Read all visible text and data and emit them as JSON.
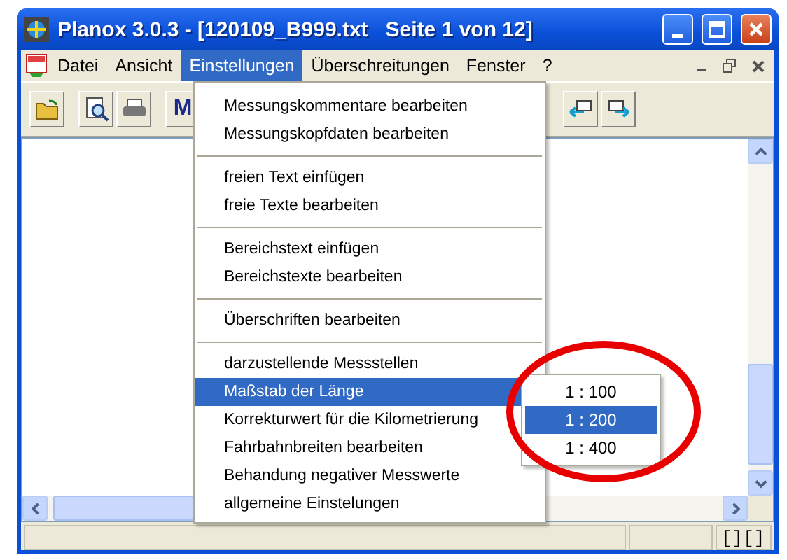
{
  "window": {
    "title": "Planox 3.0.3 - [120109_B999.txt   Seite 1 von 12]"
  },
  "menubar": [
    {
      "label": "Datei",
      "selected": false
    },
    {
      "label": "Ansicht",
      "selected": false
    },
    {
      "label": "Einstellungen",
      "selected": true
    },
    {
      "label": "Überschreitungen",
      "selected": false
    },
    {
      "label": "Fenster",
      "selected": false
    },
    {
      "label": "?",
      "selected": false
    }
  ],
  "toolbar": {
    "letter_button": "M"
  },
  "menu": [
    {
      "kind": "item",
      "label": "Messungskommentare bearbeiten",
      "selected": false
    },
    {
      "kind": "item",
      "label": "Messungskopfdaten bearbeiten",
      "selected": false
    },
    {
      "kind": "separator"
    },
    {
      "kind": "item",
      "label": "freien Text einfügen",
      "selected": false
    },
    {
      "kind": "item",
      "label": "freie Texte bearbeiten",
      "selected": false
    },
    {
      "kind": "separator"
    },
    {
      "kind": "item",
      "label": "Bereichstext einfügen",
      "selected": false
    },
    {
      "kind": "item",
      "label": "Bereichstexte bearbeiten",
      "selected": false
    },
    {
      "kind": "separator"
    },
    {
      "kind": "item",
      "label": "Überschriften bearbeiten",
      "selected": false
    },
    {
      "kind": "separator"
    },
    {
      "kind": "item",
      "label": "darzustellende Messstellen",
      "selected": false
    },
    {
      "kind": "submenu",
      "label": "Maßstab der Länge",
      "selected": true
    },
    {
      "kind": "item",
      "label": "Korrekturwert für die Kilometrierung",
      "selected": false
    },
    {
      "kind": "item",
      "label": "Fahrbahnbreiten bearbeiten",
      "selected": false
    },
    {
      "kind": "item",
      "label": "Behandung negativer Messwerte",
      "selected": false
    },
    {
      "kind": "item",
      "label": "allgemeine Einstelungen",
      "selected": false
    }
  ],
  "submenu": [
    {
      "label": "1 : 100",
      "selected": false
    },
    {
      "label": "1 : 200",
      "selected": true
    },
    {
      "label": "1 : 400",
      "selected": false
    }
  ],
  "status_bar": {
    "panel_3": "[][]"
  }
}
